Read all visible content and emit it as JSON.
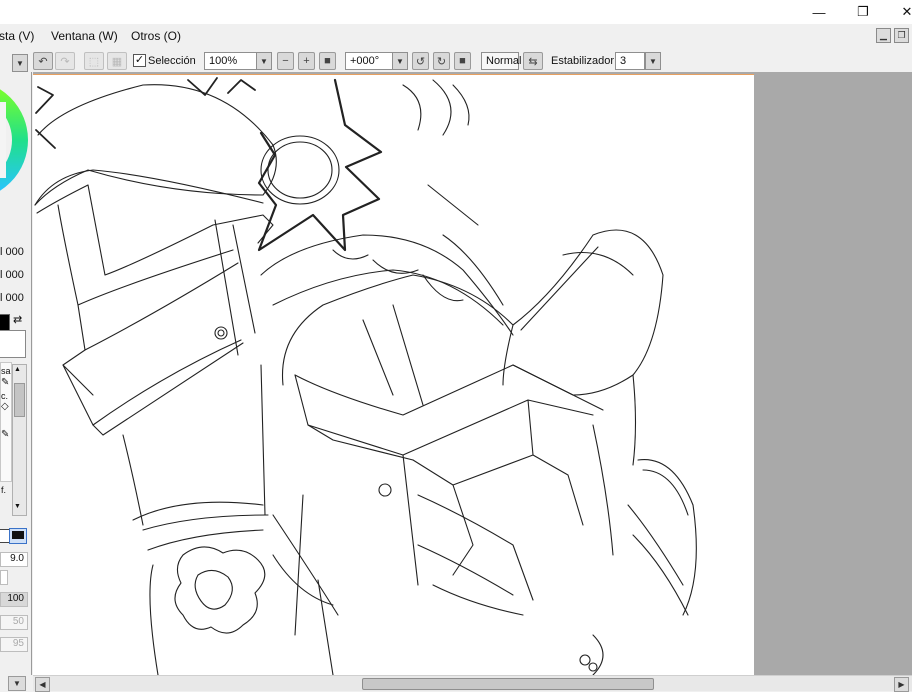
{
  "titlebar": {
    "minimize_glyph": "—",
    "restore_glyph": "❐",
    "close_glyph": "✕"
  },
  "menubar": {
    "items": [
      "sta (V)",
      "Ventana (W)",
      "Otros (O)"
    ]
  },
  "toolbar": {
    "selection_label": "Selección",
    "selection_checked": true,
    "zoom_value": "100%",
    "rotation_value": "+000°",
    "blend_mode": "Normal",
    "stabilizer_label": "Estabilizador",
    "stabilizer_value": "3"
  },
  "left_panel": {
    "rgb_values": [
      "000",
      "000",
      "000"
    ],
    "tool_labels": [
      "sa",
      "c.",
      "f."
    ],
    "brush_size": "9.0",
    "density_value": "100",
    "disabled_values": [
      "50",
      "95"
    ]
  },
  "colors": {
    "canvas_bg": "#a9a9a9",
    "paper": "#ffffff",
    "panel": "#f0f0f0",
    "accent_border": "#e8a060"
  }
}
